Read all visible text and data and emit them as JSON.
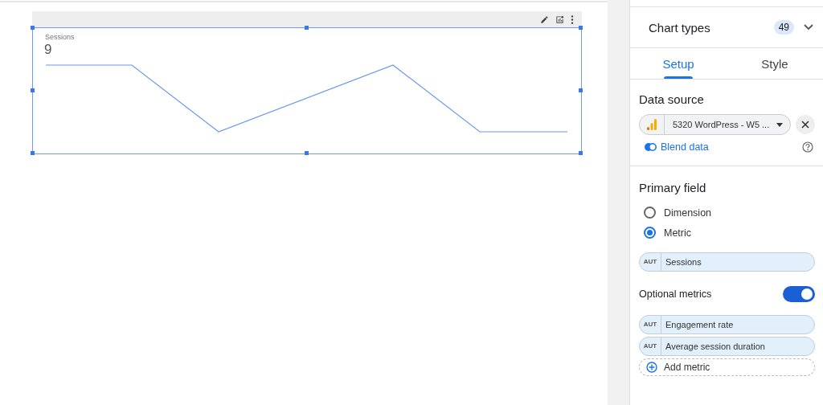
{
  "chart": {
    "label": "Sessions",
    "value": "9"
  },
  "panel": {
    "header": {
      "title": "Chart types",
      "count": "49"
    },
    "tabs": [
      {
        "label": "Setup",
        "selected": true
      },
      {
        "label": "Style",
        "selected": false
      }
    ],
    "data_source": {
      "heading": "Data source",
      "source": "5320 WordPress - W5 ...",
      "blend": "Blend data"
    },
    "primary_field": {
      "heading": "Primary field",
      "options": [
        {
          "label": "Dimension",
          "selected": false
        },
        {
          "label": "Metric",
          "selected": true
        }
      ],
      "metric": {
        "type": "AUT",
        "name": "Sessions"
      }
    },
    "optional_metrics": {
      "label": "Optional metrics",
      "on": true,
      "metrics": [
        {
          "type": "AUT",
          "name": "Engagement rate"
        },
        {
          "type": "AUT",
          "name": "Average session duration"
        }
      ],
      "add": "Add metric"
    }
  }
}
